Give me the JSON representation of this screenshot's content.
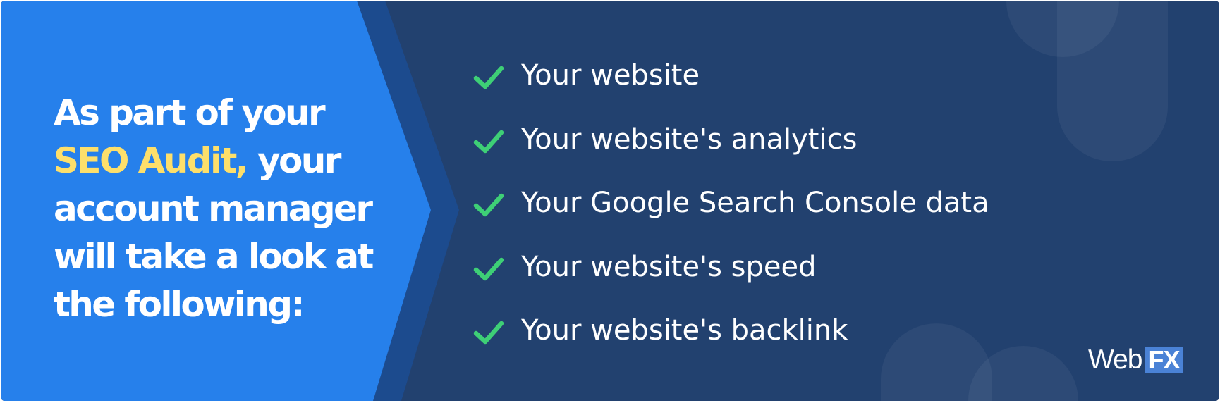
{
  "headline": {
    "line1": "As part of your",
    "highlight": "SEO Audit,",
    "line2_rest": " your",
    "line3": "account manager",
    "line4": "will take a look at",
    "line5": "the following:"
  },
  "checklist": [
    {
      "label": "Your website"
    },
    {
      "label": "Your website's analytics"
    },
    {
      "label": "Your Google Search Console data"
    },
    {
      "label": "Your website's speed"
    },
    {
      "label": "Your website's backlink"
    }
  ],
  "logo": {
    "web": "Web",
    "fx": "FX"
  },
  "colors": {
    "panel_blue": "#2680eb",
    "arrow_band": "#1c4b8e",
    "background_navy": "#22416f",
    "highlight_yellow": "#fddf6b",
    "check_green": "#3ecf76"
  }
}
